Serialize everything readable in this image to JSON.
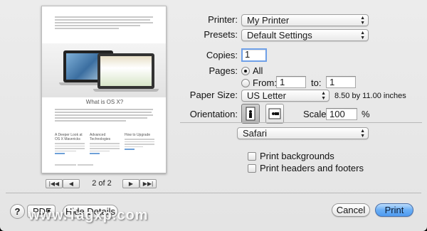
{
  "preview": {
    "heading": "What is OS X?",
    "columns": [
      {
        "title": "A Deeper Look at OS X Mavericks"
      },
      {
        "title": "Advanced Technologies"
      },
      {
        "title": "How to Upgrade"
      }
    ]
  },
  "page_nav": {
    "first_icon": "first-page-icon",
    "prev_icon": "previous-page-icon",
    "counter": "2 of 2",
    "next_icon": "next-page-icon",
    "last_icon": "last-page-icon"
  },
  "printer": {
    "label": "Printer:",
    "value": "My Printer"
  },
  "presets": {
    "label": "Presets:",
    "value": "Default Settings"
  },
  "copies": {
    "label": "Copies:",
    "value": "1"
  },
  "pages": {
    "label": "Pages:",
    "all_label": "All",
    "from_label": "From:",
    "from_value": "1",
    "to_label": "to:",
    "to_value": "1"
  },
  "paper_size": {
    "label": "Paper Size:",
    "value": "US Letter",
    "dimensions": "8.50 by 11.00 inches"
  },
  "orientation": {
    "label": "Orientation:"
  },
  "scale": {
    "label": "Scale:",
    "value": "100",
    "unit": "%"
  },
  "section": {
    "value": "Safari"
  },
  "options": {
    "print_backgrounds": "Print backgrounds",
    "print_headers_footers": "Print headers and footers"
  },
  "footer": {
    "help": "?",
    "pdf": "PDF",
    "hide_details": "Hide Details",
    "cancel": "Cancel",
    "print": "Print"
  },
  "watermark": "www.Tagxp.com",
  "colors": {
    "accent": "#6aaef5",
    "focus_ring": "#6fa0e8"
  }
}
